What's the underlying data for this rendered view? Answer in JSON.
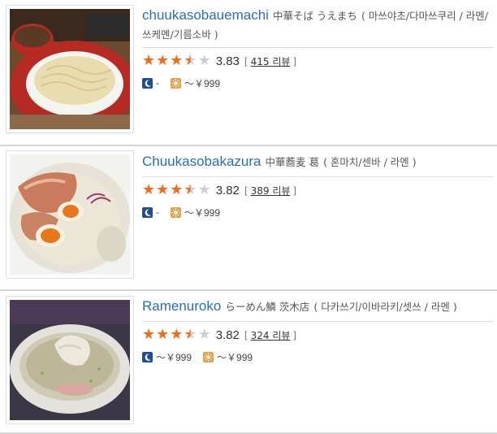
{
  "restaurants": [
    {
      "name": "chuukasobauemachi",
      "name_jp": "中華そば うえまち",
      "categories_open": "( ",
      "categories": "마쓰야초/다마쓰쿠리 / 라멘/쓰케멘/기름소바",
      "categories_close": " )",
      "rating": "3.83",
      "rating_value": 3.5,
      "review_open": "[",
      "review_label": "415 리뷰",
      "review_close": "]",
      "dinner_price": "-",
      "lunch_price": "～￥999",
      "photo": "bowl of tsukemen noodles with dipping broth on red plate"
    },
    {
      "name": "Chuukasobakazura",
      "name_jp": "中華蕎麦 葛",
      "categories_open": "( ",
      "categories": "혼마치/센바 / 라멘",
      "categories_close": " )",
      "rating": "3.82",
      "rating_value": 3.5,
      "review_open": "[",
      "review_label": "389 리뷰",
      "review_close": "]",
      "dinner_price": "-",
      "lunch_price": "～￥999",
      "photo": "creamy ramen with chashu and soft-boiled eggs"
    },
    {
      "name": "Ramenuroko",
      "name_jp": "らーめん鱗 茨木店",
      "categories_open": "( ",
      "categories": "다카쓰기/이바라키/셋쓰 / 라멘",
      "categories_close": " )",
      "rating": "3.82",
      "rating_value": 3.5,
      "review_open": "[",
      "review_label": "324 리뷰",
      "review_close": "]",
      "dinner_price": "～￥999",
      "lunch_price": "～￥999",
      "photo": "clear broth ramen topped with chashu"
    }
  ],
  "colors": {
    "link": "#2a6eb5",
    "star": "#f26b1d",
    "star_empty": "#cfcfcf",
    "dinner_icon": "#1f4d96",
    "lunch_icon": "#e6a24a"
  },
  "icons": {
    "dinner": "moon-icon",
    "lunch": "sun-icon"
  }
}
